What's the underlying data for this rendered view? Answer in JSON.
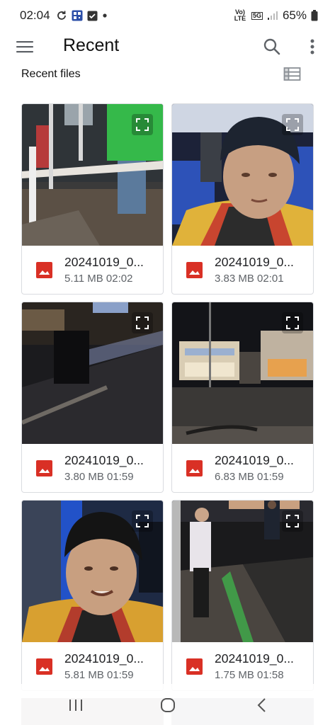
{
  "status_bar": {
    "time": "02:04",
    "network_label": "Vo) LTE",
    "signal_label": "5G",
    "battery": "65%"
  },
  "app_bar": {
    "title": "Recent",
    "menu_icon": "hamburger-menu-icon",
    "search_icon": "search-icon",
    "more_icon": "more-vert-icon"
  },
  "section": {
    "label": "Recent files",
    "view_icon": "list-view-icon"
  },
  "files": [
    {
      "name": "20241019_0...",
      "meta": "5.11 MB 02:02",
      "scene": "bus-interior"
    },
    {
      "name": "20241019_0...",
      "meta": "3.83 MB 02:01",
      "scene": "selfie-bus"
    },
    {
      "name": "20241019_0...",
      "meta": "3.80 MB 01:59",
      "scene": "blurry-street"
    },
    {
      "name": "20241019_0...",
      "meta": "6.83 MB 01:59",
      "scene": "night-mcdonalds"
    },
    {
      "name": "20241019_0...",
      "meta": "5.81 MB 01:59",
      "scene": "selfie-street"
    },
    {
      "name": "20241019_0...",
      "meta": "1.75 MB 01:58",
      "scene": "night-sidewalk"
    }
  ],
  "colors": {
    "accent_red": "#d93025",
    "text_primary": "#202124",
    "text_secondary": "#5f6368",
    "card_border": "#dadce0"
  },
  "nav": {
    "recents_icon": "recent-apps-icon",
    "home_icon": "home-icon",
    "back_icon": "back-icon"
  }
}
